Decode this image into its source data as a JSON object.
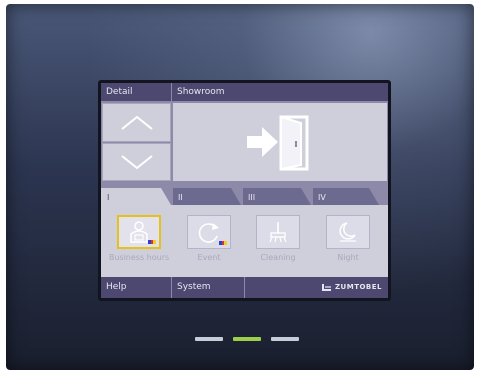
{
  "header": {
    "detail_label": "Detail",
    "room_name": "Showroom"
  },
  "room_controls": {
    "up_icon": "chevron-up-icon",
    "down_icon": "chevron-down-icon",
    "room_icon": "door-enter-icon"
  },
  "tabs": [
    {
      "label": "I",
      "active": true
    },
    {
      "label": "II",
      "active": false
    },
    {
      "label": "III",
      "active": false
    },
    {
      "label": "IV",
      "active": false
    }
  ],
  "scenes": [
    {
      "label": "Business hours",
      "icon": "person-desk-icon",
      "selected": true,
      "color_badge": true
    },
    {
      "label": "Event",
      "icon": "refresh-icon",
      "selected": false,
      "color_badge": true
    },
    {
      "label": "Cleaning",
      "icon": "broom-icon",
      "selected": false,
      "color_badge": false
    },
    {
      "label": "Night",
      "icon": "moon-icon",
      "selected": false,
      "color_badge": false
    }
  ],
  "footer": {
    "help_label": "Help",
    "system_label": "System",
    "brand": "ZUMTOBEL"
  },
  "leds": {
    "active_index": 1,
    "active_color": "#9ad04a"
  },
  "colors": {
    "header_bar": "#4c4870",
    "content_bg": "#cfcfdc",
    "selected_border": "#e3c21e"
  }
}
